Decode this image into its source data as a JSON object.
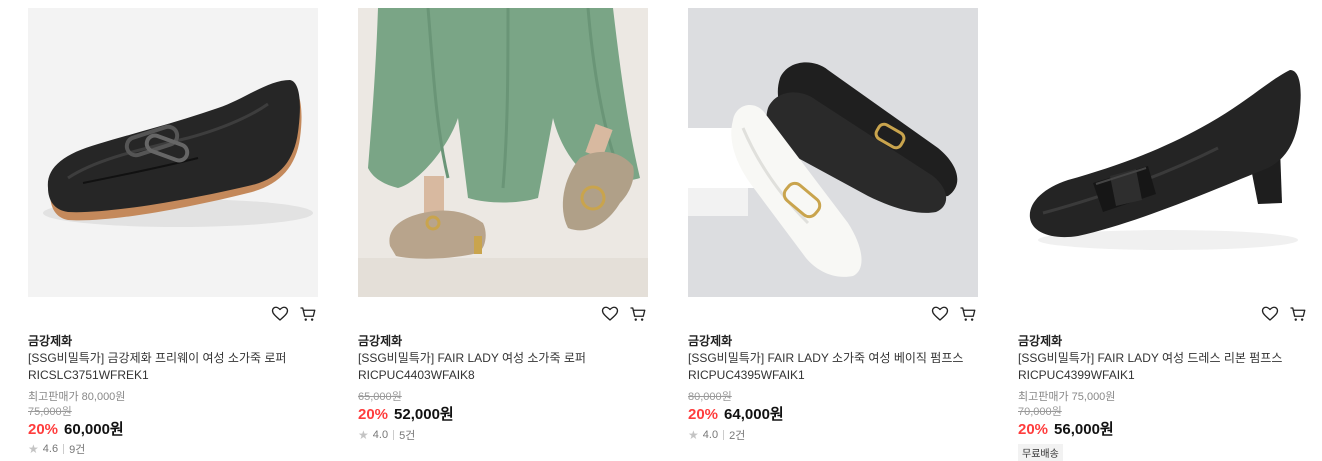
{
  "icons": {
    "wishlist": "heart-icon",
    "cart": "cart-icon",
    "rating": "star-icon"
  },
  "colors": {
    "discount": "#ff3d3d",
    "price": "#111111",
    "star": "#c4c4c4"
  },
  "products": [
    {
      "brand": "금강제화",
      "title": "[SSG비밀특가] 금강제화 프리웨이 여성 소가죽 로퍼 RICSLC3751WFREK1",
      "max_price": "최고판매가 80,000원",
      "original_price": "75,000원",
      "discount": "20%",
      "price": "60,000원",
      "rating": "4.6",
      "reviews": "9건"
    },
    {
      "brand": "금강제화",
      "title": "[SSG비밀특가] FAIR LADY 여성 소가죽 로퍼 RICPUC4403WFAIK8",
      "original_price": "65,000원",
      "discount": "20%",
      "price": "52,000원",
      "rating": "4.0",
      "reviews": "5건"
    },
    {
      "brand": "금강제화",
      "title": "[SSG비밀특가] FAIR LADY 소가죽 여성 베이직 펌프스 RICPUC4395WFAIK1",
      "original_price": "80,000원",
      "discount": "20%",
      "price": "64,000원",
      "rating": "4.0",
      "reviews": "2건"
    },
    {
      "brand": "금강제화",
      "title": "[SSG비밀특가] FAIR LADY 여성 드레스 리본 펌프스 RICPUC4399WFAIK1",
      "max_price": "최고판매가 75,000원",
      "original_price": "70,000원",
      "discount": "20%",
      "price": "56,000원",
      "badge": "무료배송"
    }
  ]
}
